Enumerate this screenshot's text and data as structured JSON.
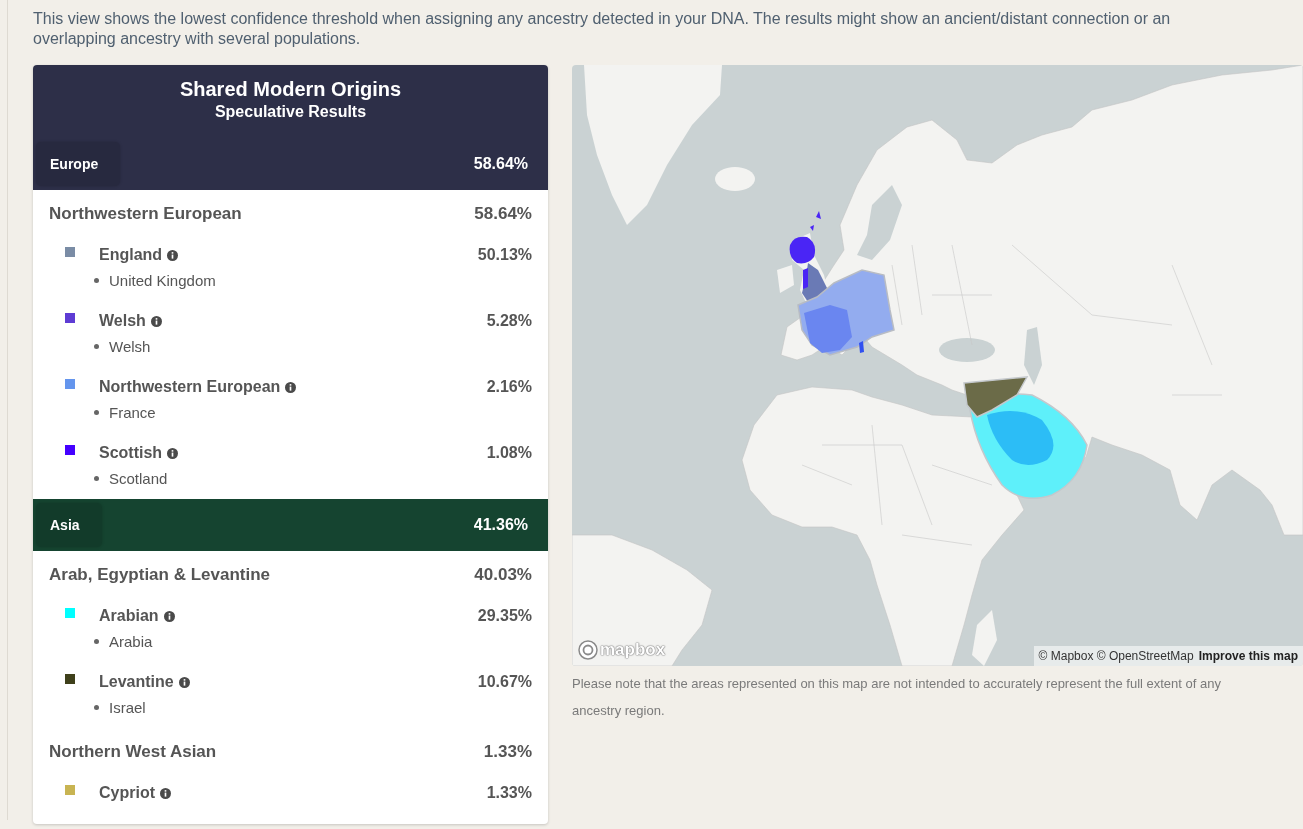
{
  "intro": "This view shows the lowest confidence threshold when assigning any ancestry detected in your DNA. The results might show an ancient/distant connection or an overlapping ancestry with several populations.",
  "card": {
    "title": "Shared Modern Origins",
    "subtitle": "Speculative Results",
    "regions": [
      {
        "name": "Europe",
        "percent": "58.64%",
        "color": "#2d2f48",
        "groups": [
          {
            "name": "Northwestern European",
            "percent": "58.64%",
            "populations": [
              {
                "name": "England",
                "percent": "50.13%",
                "color": "#7a8ca5",
                "locations": [
                  "United Kingdom"
                ]
              },
              {
                "name": "Welsh",
                "percent": "5.28%",
                "color": "#5e3cd4",
                "locations": [
                  "Welsh"
                ]
              },
              {
                "name": "Northwestern European",
                "percent": "2.16%",
                "color": "#6495ed",
                "locations": [
                  "France"
                ]
              },
              {
                "name": "Scottish",
                "percent": "1.08%",
                "color": "#4400ff",
                "locations": [
                  "Scotland"
                ]
              }
            ]
          }
        ]
      },
      {
        "name": "Asia",
        "percent": "41.36%",
        "color": "#154430",
        "groups": [
          {
            "name": "Arab, Egyptian & Levantine",
            "percent": "40.03%",
            "populations": [
              {
                "name": "Arabian",
                "percent": "29.35%",
                "color": "#00ffff",
                "locations": [
                  "Arabia"
                ]
              },
              {
                "name": "Levantine",
                "percent": "10.67%",
                "color": "#3f401b",
                "locations": [
                  "Israel"
                ]
              }
            ]
          },
          {
            "name": "Northern West Asian",
            "percent": "1.33%",
            "populations": [
              {
                "name": "Cypriot",
                "percent": "1.33%",
                "color": "#c8b452"
              }
            ]
          }
        ]
      }
    ]
  },
  "map": {
    "logo": "mapbox",
    "attribution": "© Mapbox © OpenStreetMap",
    "link": "Improve this map"
  },
  "map_note": "Please note that the areas represented on this map are not intended to accurately represent the full extent of any ancestry region."
}
